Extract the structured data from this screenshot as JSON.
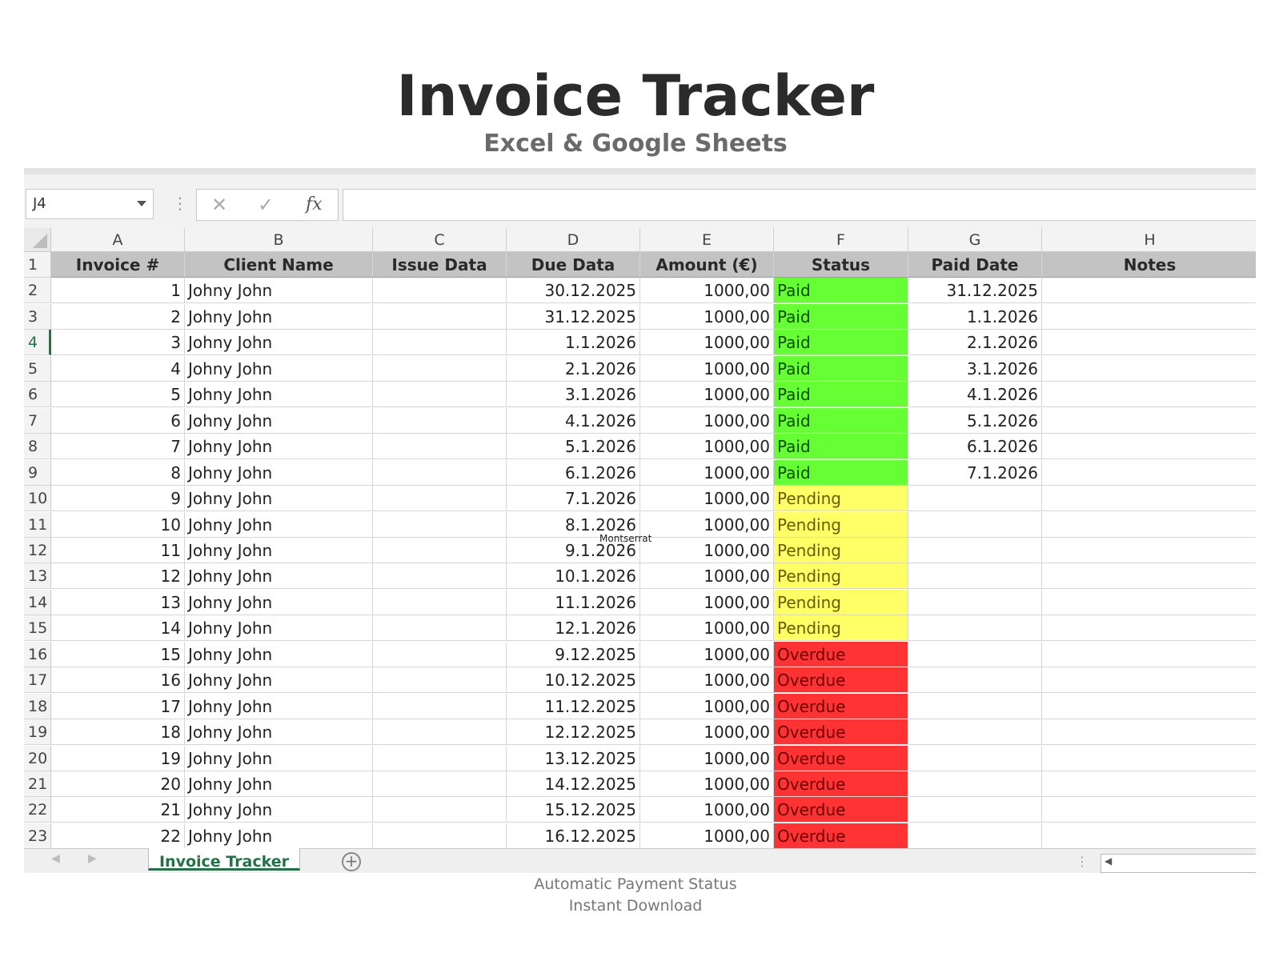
{
  "header": {
    "title": "Invoice Tracker",
    "subtitle": "Excel & Google Sheets"
  },
  "formula_bar": {
    "name_box": "J4",
    "cancel_icon": "x-icon",
    "enter_icon": "check-icon",
    "fx_label": "fx",
    "formula_value": ""
  },
  "columns": [
    "A",
    "B",
    "C",
    "D",
    "E",
    "F",
    "G",
    "H"
  ],
  "headers": [
    "Invoice #",
    "Client Name",
    "Issue Data",
    "Due Data",
    "Amount (€)",
    "Status",
    "Paid Date",
    "Notes"
  ],
  "rows": [
    {
      "n": "2",
      "inv": "1",
      "client": "Johny John",
      "issue": "",
      "due": "30.12.2025",
      "amount": "1000,00",
      "status": "Paid",
      "paid": "31.12.2025",
      "notes": ""
    },
    {
      "n": "3",
      "inv": "2",
      "client": "Johny John",
      "issue": "",
      "due": "31.12.2025",
      "amount": "1000,00",
      "status": "Paid",
      "paid": "1.1.2026",
      "notes": ""
    },
    {
      "n": "4",
      "inv": "3",
      "client": "Johny John",
      "issue": "",
      "due": "1.1.2026",
      "amount": "1000,00",
      "status": "Paid",
      "paid": "2.1.2026",
      "notes": ""
    },
    {
      "n": "5",
      "inv": "4",
      "client": "Johny John",
      "issue": "",
      "due": "2.1.2026",
      "amount": "1000,00",
      "status": "Paid",
      "paid": "3.1.2026",
      "notes": ""
    },
    {
      "n": "6",
      "inv": "5",
      "client": "Johny John",
      "issue": "",
      "due": "3.1.2026",
      "amount": "1000,00",
      "status": "Paid",
      "paid": "4.1.2026",
      "notes": ""
    },
    {
      "n": "7",
      "inv": "6",
      "client": "Johny John",
      "issue": "",
      "due": "4.1.2026",
      "amount": "1000,00",
      "status": "Paid",
      "paid": "5.1.2026",
      "notes": ""
    },
    {
      "n": "8",
      "inv": "7",
      "client": "Johny John",
      "issue": "",
      "due": "5.1.2026",
      "amount": "1000,00",
      "status": "Paid",
      "paid": "6.1.2026",
      "notes": ""
    },
    {
      "n": "9",
      "inv": "8",
      "client": "Johny John",
      "issue": "",
      "due": "6.1.2026",
      "amount": "1000,00",
      "status": "Paid",
      "paid": "7.1.2026",
      "notes": ""
    },
    {
      "n": "10",
      "inv": "9",
      "client": "Johny John",
      "issue": "",
      "due": "7.1.2026",
      "amount": "1000,00",
      "status": "Pending",
      "paid": "",
      "notes": ""
    },
    {
      "n": "11",
      "inv": "10",
      "client": "Johny John",
      "issue": "",
      "due": "8.1.2026",
      "amount": "1000,00",
      "status": "Pending",
      "paid": "",
      "notes": ""
    },
    {
      "n": "12",
      "inv": "11",
      "client": "Johny John",
      "issue": "",
      "due": "9.1.2026",
      "amount": "1000,00",
      "status": "Pending",
      "paid": "",
      "notes": ""
    },
    {
      "n": "13",
      "inv": "12",
      "client": "Johny John",
      "issue": "",
      "due": "10.1.2026",
      "amount": "1000,00",
      "status": "Pending",
      "paid": "",
      "notes": ""
    },
    {
      "n": "14",
      "inv": "13",
      "client": "Johny John",
      "issue": "",
      "due": "11.1.2026",
      "amount": "1000,00",
      "status": "Pending",
      "paid": "",
      "notes": ""
    },
    {
      "n": "15",
      "inv": "14",
      "client": "Johny John",
      "issue": "",
      "due": "12.1.2026",
      "amount": "1000,00",
      "status": "Pending",
      "paid": "",
      "notes": ""
    },
    {
      "n": "16",
      "inv": "15",
      "client": "Johny John",
      "issue": "",
      "due": "9.12.2025",
      "amount": "1000,00",
      "status": "Overdue",
      "paid": "",
      "notes": ""
    },
    {
      "n": "17",
      "inv": "16",
      "client": "Johny John",
      "issue": "",
      "due": "10.12.2025",
      "amount": "1000,00",
      "status": "Overdue",
      "paid": "",
      "notes": ""
    },
    {
      "n": "18",
      "inv": "17",
      "client": "Johny John",
      "issue": "",
      "due": "11.12.2025",
      "amount": "1000,00",
      "status": "Overdue",
      "paid": "",
      "notes": ""
    },
    {
      "n": "19",
      "inv": "18",
      "client": "Johny John",
      "issue": "",
      "due": "12.12.2025",
      "amount": "1000,00",
      "status": "Overdue",
      "paid": "",
      "notes": ""
    },
    {
      "n": "20",
      "inv": "19",
      "client": "Johny John",
      "issue": "",
      "due": "13.12.2025",
      "amount": "1000,00",
      "status": "Overdue",
      "paid": "",
      "notes": ""
    },
    {
      "n": "21",
      "inv": "20",
      "client": "Johny John",
      "issue": "",
      "due": "14.12.2025",
      "amount": "1000,00",
      "status": "Overdue",
      "paid": "",
      "notes": ""
    },
    {
      "n": "22",
      "inv": "21",
      "client": "Johny John",
      "issue": "",
      "due": "15.12.2025",
      "amount": "1000,00",
      "status": "Overdue",
      "paid": "",
      "notes": ""
    },
    {
      "n": "23",
      "inv": "22",
      "client": "Johny John",
      "issue": "",
      "due": "16.12.2025",
      "amount": "1000,00",
      "status": "Overdue",
      "paid": "",
      "notes": ""
    }
  ],
  "active_row": "4",
  "status_colors": {
    "Paid": "#66ff33",
    "Pending": "#ffff66",
    "Overdue": "#ff3333"
  },
  "tooltip_text": "Montserrat",
  "sheet_tabs": {
    "active": "Invoice Tracker",
    "add_icon": "plus-circle-icon"
  },
  "footer": {
    "line1": "Automatic Payment Status",
    "line2": "Instant Download"
  }
}
